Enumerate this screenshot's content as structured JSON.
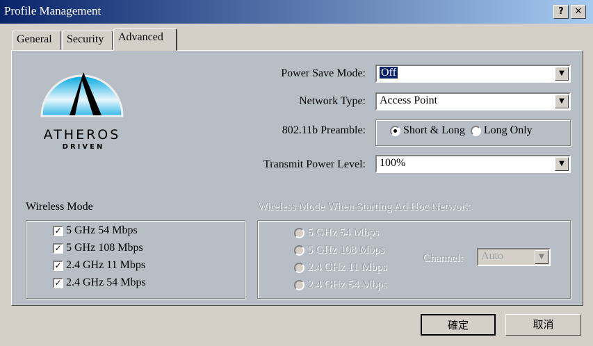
{
  "window": {
    "title": "Profile Management",
    "help_label": "?",
    "close_label": "✕"
  },
  "tabs": [
    {
      "label": "General"
    },
    {
      "label": "Security"
    },
    {
      "label": "Advanced",
      "active": true
    }
  ],
  "logo": {
    "text_line1": "ATHEROS",
    "text_line2": "DRIVEN"
  },
  "power_save": {
    "label": "Power Save Mode:",
    "value": "Off"
  },
  "network_type": {
    "label": "Network Type:",
    "value": "Access Point"
  },
  "preamble": {
    "label": "802.11b Preamble:",
    "options": [
      {
        "label": "Short & Long",
        "selected": true
      },
      {
        "label": "Long Only",
        "selected": false
      }
    ]
  },
  "transmit_power": {
    "label": "Transmit Power Level:",
    "value": "100%"
  },
  "wireless_mode": {
    "label": "Wireless Mode",
    "items": [
      {
        "label": "5 GHz 54 Mbps",
        "checked": true
      },
      {
        "label": "5 GHz 108 Mbps",
        "checked": true
      },
      {
        "label": "2.4 GHz 11 Mbps",
        "checked": true
      },
      {
        "label": "2.4 GHz 54 Mbps",
        "checked": true
      }
    ]
  },
  "adhoc": {
    "label": "Wireless Mode When Starting Ad Hoc Network",
    "items": [
      {
        "label": "5 GHz 54 Mbps"
      },
      {
        "label": "5 GHz 108 Mbps"
      },
      {
        "label": "2.4 GHz 11 Mbps"
      },
      {
        "label": "2.4 GHz 54 Mbps"
      }
    ],
    "channel_label": "Channel:",
    "channel_value": "Auto"
  },
  "buttons": {
    "ok": "確定",
    "cancel": "取消"
  },
  "colors": {
    "title_start": "#0a246a",
    "title_end": "#a6caf0",
    "panel": "#b8bec6",
    "dialog": "#d4d0c8"
  }
}
